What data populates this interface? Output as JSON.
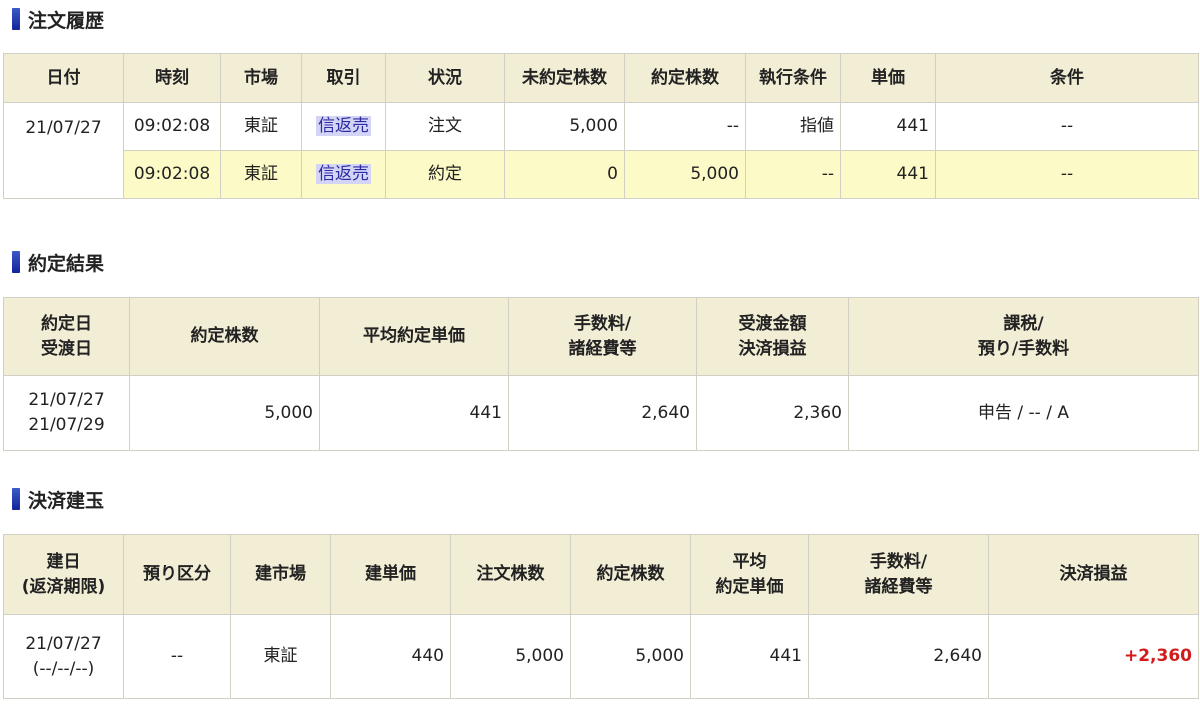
{
  "order_history": {
    "title": "注文履歴",
    "headers": [
      "日付",
      "時刻",
      "市場",
      "取引",
      "状況",
      "未約定株数",
      "約定株数",
      "執行条件",
      "単価",
      "条件"
    ],
    "date": "21/07/27",
    "rows": [
      {
        "time": "09:02:08",
        "market": "東証",
        "trade": "信返売",
        "status": "注文",
        "unfilled": "5,000",
        "filled": "--",
        "exec_cond": "指値",
        "price": "441",
        "condition": "--"
      },
      {
        "time": "09:02:08",
        "market": "東証",
        "trade": "信返売",
        "status": "約定",
        "unfilled": "0",
        "filled": "5,000",
        "exec_cond": "--",
        "price": "441",
        "condition": "--"
      }
    ]
  },
  "execution_result": {
    "title": "約定結果",
    "headers": [
      {
        "line1": "約定日",
        "line2": "受渡日"
      },
      {
        "line1": "約定株数",
        "line2": ""
      },
      {
        "line1": "平均約定単価",
        "line2": ""
      },
      {
        "line1": "手数料/",
        "line2": "諸経費等"
      },
      {
        "line1": "受渡金額",
        "line2": "決済損益"
      },
      {
        "line1": "課税/",
        "line2": "預り/手数料"
      }
    ],
    "row": {
      "trade_date": "21/07/27",
      "settle_date": "21/07/29",
      "shares": "5,000",
      "avg_price": "441",
      "fees": "2,640",
      "amount": "2,360",
      "tax": "申告 / -- / A"
    }
  },
  "settlement_positions": {
    "title": "決済建玉",
    "headers": [
      {
        "line1": "建日",
        "line2": "(返済期限)"
      },
      {
        "line1": "預り区分",
        "line2": ""
      },
      {
        "line1": "建市場",
        "line2": ""
      },
      {
        "line1": "建単価",
        "line2": ""
      },
      {
        "line1": "注文株数",
        "line2": ""
      },
      {
        "line1": "約定株数",
        "line2": ""
      },
      {
        "line1": "平均",
        "line2": "約定単価"
      },
      {
        "line1": "手数料/",
        "line2": "諸経費等"
      },
      {
        "line1": "決済損益",
        "line2": ""
      }
    ],
    "row": {
      "open_date": "21/07/27",
      "deadline": "(--/--/--)",
      "custody": "--",
      "market": "東証",
      "open_price": "440",
      "order_shares": "5,000",
      "filled_shares": "5,000",
      "avg_price": "441",
      "fees": "2,640",
      "pnl": "+2,360"
    }
  },
  "colors": {
    "header_bg": "#f2eed6",
    "highlight_row": "#fcfac6",
    "profit": "#d21c1c",
    "section_bar": "#1b2fa8",
    "trade_link_bg": "#d4d4f6"
  }
}
